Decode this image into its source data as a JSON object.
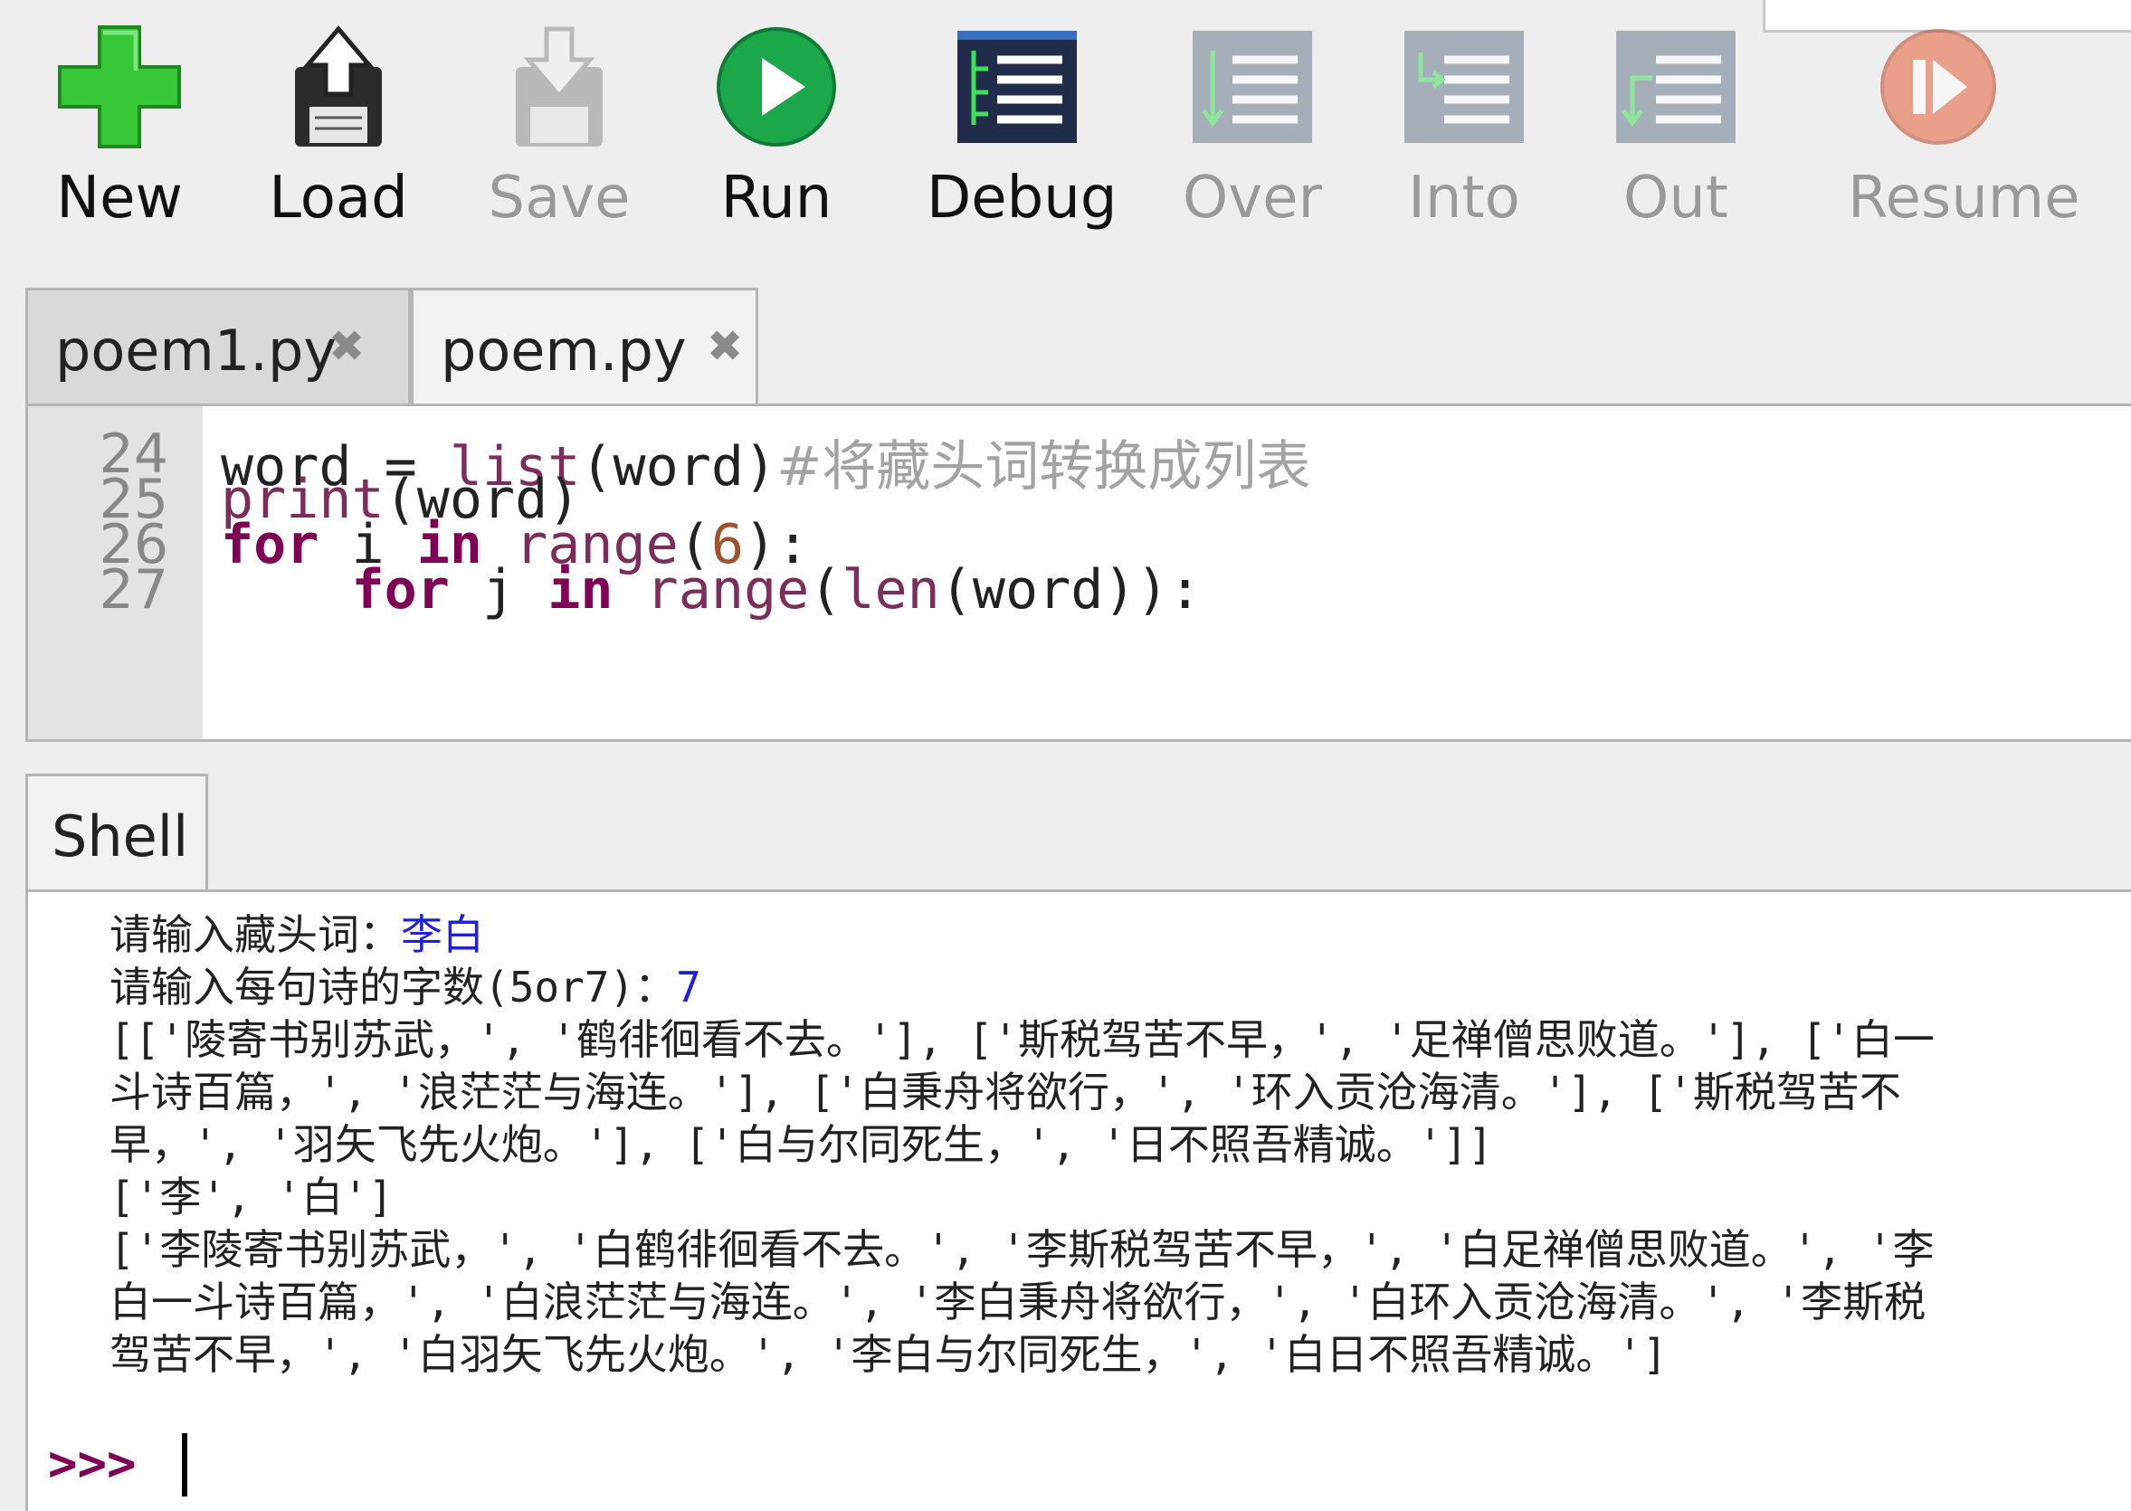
{
  "toolbar": {
    "new_label": "New",
    "load_label": "Load",
    "save_label": "Save",
    "run_label": "Run",
    "debug_label": "Debug",
    "over_label": "Over",
    "into_label": "Into",
    "out_label": "Out",
    "resume_label": "Resume"
  },
  "tabs": [
    {
      "label": "poem1.py",
      "close": "✖"
    },
    {
      "label": "poem.py",
      "close": "✖"
    }
  ],
  "editor": {
    "lines": [
      {
        "no": "24",
        "parts": [
          {
            "t": "word = ",
            "c": ""
          },
          {
            "t": "list",
            "c": "bi"
          },
          {
            "t": "(word)",
            "c": ""
          },
          {
            "t": "#将藏头词转换成列表",
            "c": "cm"
          }
        ]
      },
      {
        "no": "25",
        "parts": [
          {
            "t": "print",
            "c": "bi"
          },
          {
            "t": "(word)",
            "c": ""
          }
        ]
      },
      {
        "no": "26",
        "parts": [
          {
            "t": "for",
            "c": "kw"
          },
          {
            "t": " i ",
            "c": ""
          },
          {
            "t": "in",
            "c": "kw"
          },
          {
            "t": " ",
            "c": ""
          },
          {
            "t": "range",
            "c": "bi"
          },
          {
            "t": "(",
            "c": ""
          },
          {
            "t": "6",
            "c": "num"
          },
          {
            "t": "):",
            "c": ""
          }
        ]
      },
      {
        "no": "27",
        "parts": [
          {
            "t": "    ",
            "c": ""
          },
          {
            "t": "for",
            "c": "kw"
          },
          {
            "t": " j ",
            "c": ""
          },
          {
            "t": "in",
            "c": "kw"
          },
          {
            "t": " ",
            "c": ""
          },
          {
            "t": "range",
            "c": "bi"
          },
          {
            "t": "(",
            "c": ""
          },
          {
            "t": "len",
            "c": "bi"
          },
          {
            "t": "(word)):",
            "c": ""
          }
        ]
      }
    ]
  },
  "shell": {
    "tab_label": "Shell",
    "prompt1_text": "请输入藏头词：",
    "prompt1_input": "李白",
    "prompt2_text": "请输入每句诗的字数(5or7)：",
    "prompt2_input": "7",
    "output_lines": [
      "[['陵寄书别苏武，', '鹤徘徊看不去。'], ['斯税驾苦不早，', '足禅僧思败道。'], ['白一",
      "斗诗百篇，', '浪茫茫与海连。'], ['白秉舟将欲行，', '环入贡沧海清。'], ['斯税驾苦不",
      "早，', '羽矢飞先火炮。'], ['白与尔同死生，', '日不照吾精诚。']]",
      "['李', '白']",
      "['李陵寄书别苏武，', '白鹤徘徊看不去。', '李斯税驾苦不早，', '白足禅僧思败道。', '李",
      "白一斗诗百篇，', '白浪茫茫与海连。', '李白秉舟将欲行，', '白环入贡沧海清。', '李斯税",
      "驾苦不早，', '白羽矢飞先火炮。', '李白与尔同死生，', '白日不照吾精诚。']"
    ],
    "prompt_symbol": ">>>"
  },
  "colors": {
    "new_green": "#37c837",
    "run_green": "#1aa84a",
    "debug_navy": "#1f2d4a",
    "resume_orange": "#e8603c"
  },
  "icons": {
    "new": "plus-icon",
    "load": "load-floppy-icon",
    "save": "save-floppy-icon",
    "run": "play-icon",
    "debug": "debug-icon",
    "over": "step-over-icon",
    "into": "step-into-icon",
    "out": "step-out-icon",
    "resume": "resume-icon"
  }
}
